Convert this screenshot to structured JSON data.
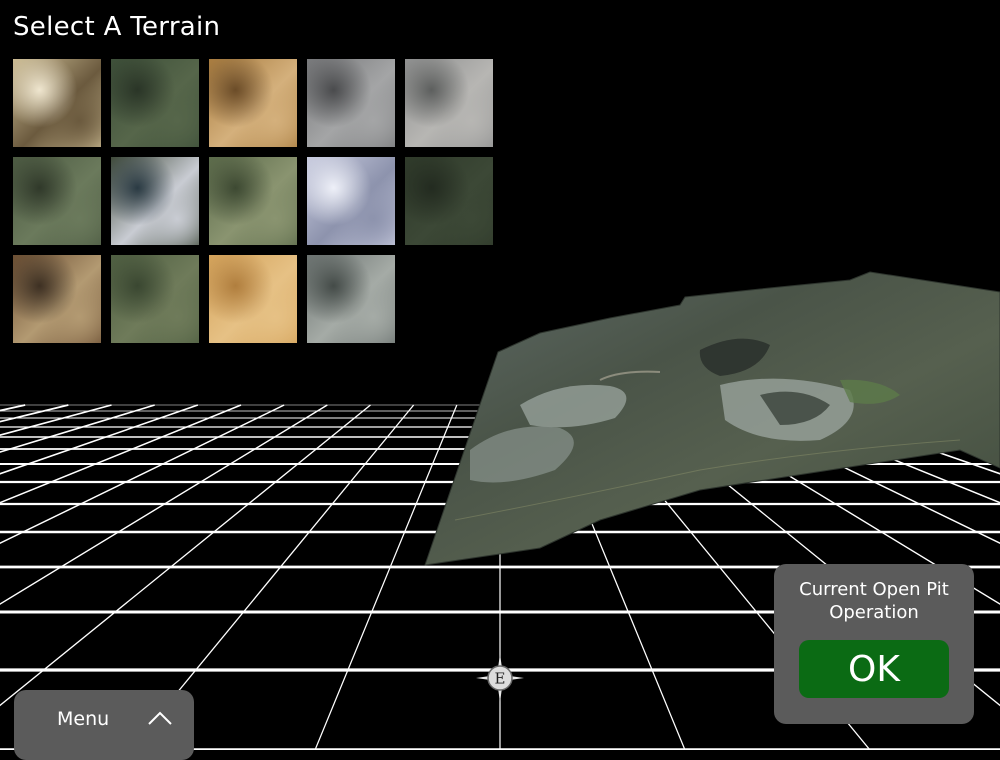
{
  "header": {
    "title": "Select A Terrain"
  },
  "terrains": [
    {
      "name": "terrain-desert-riverbed",
      "c1": "#cdbd95",
      "c2": "#6b5a3e",
      "c3": "#efe6cf"
    },
    {
      "name": "terrain-green-hills",
      "c1": "#3d4f39",
      "c2": "#56664a",
      "c3": "#2a3527"
    },
    {
      "name": "terrain-arid-canyon",
      "c1": "#a77b3e",
      "c2": "#d4b07c",
      "c3": "#6b4c28"
    },
    {
      "name": "terrain-urban-gray",
      "c1": "#77787a",
      "c2": "#a4a5a6",
      "c3": "#4a4b4d"
    },
    {
      "name": "terrain-city-grid",
      "c1": "#8e8f8f",
      "c2": "#b7b6b3",
      "c3": "#5d5f5e"
    },
    {
      "name": "terrain-green-valley",
      "c1": "#4c5a42",
      "c2": "#6b7a5c",
      "c3": "#30392a"
    },
    {
      "name": "terrain-river-city",
      "c1": "#3f4a3a",
      "c2": "#c9ccd3",
      "c3": "#2a3a43"
    },
    {
      "name": "terrain-farmland",
      "c1": "#5b6a4a",
      "c2": "#8a9470",
      "c3": "#3d4932"
    },
    {
      "name": "terrain-snow-mountains",
      "c1": "#c9ccdf",
      "c2": "#8d93ad",
      "c3": "#eef0f8"
    },
    {
      "name": "terrain-dark-forest",
      "c1": "#2f3a2a",
      "c2": "#3c4836",
      "c3": "#232b20"
    },
    {
      "name": "terrain-coastline",
      "c1": "#6b4e33",
      "c2": "#b39a72",
      "c3": "#3d3023"
    },
    {
      "name": "terrain-mixed-scrub",
      "c1": "#4e5e41",
      "c2": "#6f7b5a",
      "c3": "#3a4731"
    },
    {
      "name": "terrain-sand-dunes",
      "c1": "#d3a25a",
      "c2": "#e6c185",
      "c3": "#b07e3e"
    },
    {
      "name": "terrain-open-pit-mine",
      "c1": "#6b7270",
      "c2": "#a5aba6",
      "c3": "#444b48"
    }
  ],
  "menu": {
    "label": "Menu",
    "icon": "chevron-up-icon"
  },
  "info": {
    "line1": "Current Open Pit",
    "line2": "Operation",
    "ok_label": "OK"
  },
  "compass": {
    "letter": "E"
  },
  "colors": {
    "background": "#000000",
    "panel": "#5b5b5b",
    "ok_button": "#0b6b14",
    "grid": "#ffffff"
  }
}
